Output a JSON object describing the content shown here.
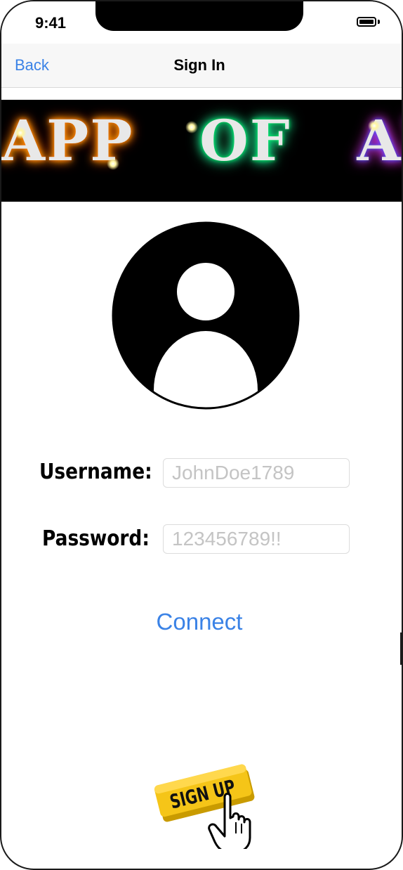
{
  "status_bar": {
    "time": "9:41",
    "battery_icon": "battery-full-icon"
  },
  "nav_bar": {
    "back_label": "Back",
    "title": "Sign In"
  },
  "banner": {
    "logo_word_1": "APP",
    "logo_word_2": "OF",
    "logo_word_3": "APPS"
  },
  "avatar": {
    "icon": "user-avatar-icon"
  },
  "form": {
    "username_label": "Username:",
    "username_placeholder": "JohnDoe1789",
    "username_value": "",
    "password_label": "Password:",
    "password_placeholder": "123456789!!",
    "password_value": ""
  },
  "actions": {
    "connect_label": "Connect",
    "signup_label": "SIGN UP"
  },
  "colors": {
    "accent": "#3a82e6",
    "signup_button": "#f5c518",
    "banner_background": "#000000"
  }
}
